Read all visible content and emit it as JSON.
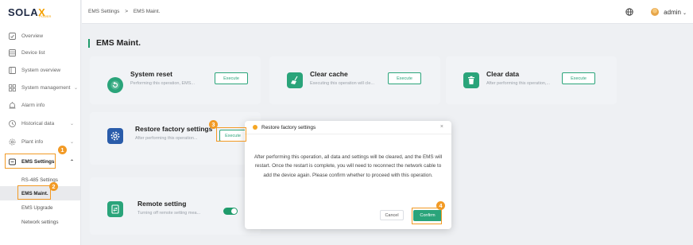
{
  "logo": {
    "brand": "SOLA",
    "brand_x": "X",
    "tagline": "POWER"
  },
  "breadcrumb": {
    "parent": "EMS Settings",
    "separator": ">",
    "current": "EMS Maint."
  },
  "header": {
    "user": "admin",
    "caret": "⌄"
  },
  "sidebar": {
    "items": [
      {
        "label": "Overview"
      },
      {
        "label": "Device list"
      },
      {
        "label": "System overview"
      },
      {
        "label": "System management"
      },
      {
        "label": "Alarm info"
      },
      {
        "label": "Historical data"
      },
      {
        "label": "Plant info"
      },
      {
        "label": "EMS Settings"
      }
    ],
    "sub_items": [
      {
        "label": "RS-485 Settings"
      },
      {
        "label": "EMS Maint."
      },
      {
        "label": "EMS Upgrade"
      },
      {
        "label": "Network settings"
      }
    ]
  },
  "page_title": "EMS Maint.",
  "cards": {
    "system_reset": {
      "title": "System reset",
      "desc": "Performing this operation, EMS...",
      "button": "Execute"
    },
    "clear_cache": {
      "title": "Clear cache",
      "desc": "Executing this operation will cle...",
      "button": "Execute"
    },
    "clear_data": {
      "title": "Clear data",
      "desc": "After performing this operation,...",
      "button": "Execute"
    },
    "restore_factory": {
      "title": "Restore factory settings",
      "desc": "After performing this operation...",
      "button": "Execute"
    },
    "remote_setting": {
      "title": "Remote setting",
      "desc": "Turning off remote setting mea...",
      "toggle_on": true
    }
  },
  "modal": {
    "title": "Restore factory settings",
    "close": "×",
    "body": "After performing this operation, all data and settings will be cleared, and the EMS will restart. Once the restart is complete, you will need to reconnect the network cable to add the device again. Please confirm whether to proceed with this operation.",
    "cancel": "Cancel",
    "confirm": "Confirm"
  },
  "annotations": [
    "1",
    "2",
    "3",
    "4"
  ],
  "colors": {
    "accent": "#2aa47a",
    "highlight": "#f29a25",
    "warning": "#f5a623"
  }
}
